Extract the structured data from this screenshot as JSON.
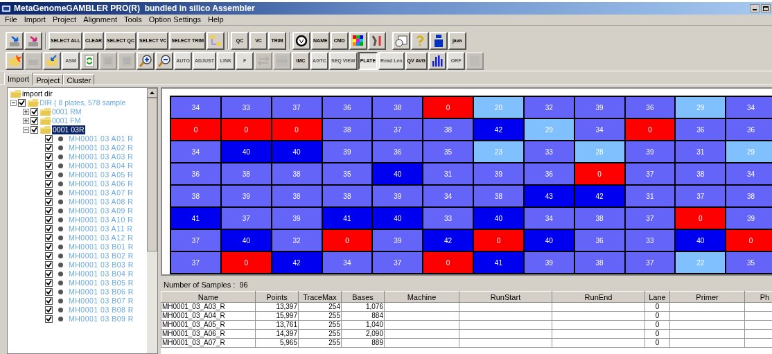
{
  "window": {
    "title": "MetaGenomeGAMBLER PRO(R)  bundled in silico Assembler"
  },
  "menu": [
    "File",
    "Import",
    "Project",
    "Alignment",
    "Tools",
    "Option Settings",
    "Help"
  ],
  "toolbars": [
    [
      {
        "kind": "icon",
        "disabled": false
      },
      {
        "kind": "icon",
        "disabled": false
      },
      {
        "kind": "sep"
      },
      {
        "kind": "text",
        "label": "SELECT ALL",
        "disabled": false
      },
      {
        "kind": "text",
        "label": "CLEAR",
        "disabled": false
      },
      {
        "kind": "text",
        "label": "SELECT QC",
        "disabled": false
      },
      {
        "kind": "text",
        "label": "SELECT VC",
        "disabled": false
      },
      {
        "kind": "text",
        "label": "SELECT TRIM",
        "disabled": false
      },
      {
        "kind": "icon",
        "disabled": false
      },
      {
        "kind": "sep"
      },
      {
        "kind": "text",
        "label": "QC",
        "disabled": false
      },
      {
        "kind": "text",
        "label": "VC",
        "disabled": false
      },
      {
        "kind": "text",
        "label": "TRIM",
        "disabled": false
      },
      {
        "kind": "sep"
      },
      {
        "kind": "icon",
        "disabled": false
      },
      {
        "kind": "text",
        "label": "NAME",
        "disabled": false
      },
      {
        "kind": "text",
        "label": "CMD",
        "disabled": false
      },
      {
        "kind": "icon",
        "disabled": false
      },
      {
        "kind": "icon",
        "disabled": false
      },
      {
        "kind": "sep"
      },
      {
        "kind": "icon",
        "disabled": false
      },
      {
        "kind": "icon",
        "disabled": false
      },
      {
        "kind": "icon",
        "disabled": false
      },
      {
        "kind": "text",
        "label": "java",
        "disabled": false
      }
    ],
    [
      {
        "kind": "icon",
        "disabled": false
      },
      {
        "kind": "icon",
        "disabled": true
      },
      {
        "kind": "icon",
        "disabled": false
      },
      {
        "kind": "text",
        "label": "ASM",
        "disabled": true
      },
      {
        "kind": "icon",
        "disabled": false
      },
      {
        "kind": "icon",
        "disabled": true
      },
      {
        "kind": "icon",
        "disabled": true
      },
      {
        "kind": "icon",
        "disabled": false
      },
      {
        "kind": "icon",
        "disabled": false
      },
      {
        "kind": "text",
        "label": "AUTO",
        "disabled": true
      },
      {
        "kind": "text",
        "label": "ADJUST",
        "disabled": true
      },
      {
        "kind": "text",
        "label": "LINK",
        "disabled": true
      },
      {
        "kind": "text",
        "label": "F",
        "disabled": true
      },
      {
        "kind": "icon",
        "disabled": true
      },
      {
        "kind": "icon",
        "disabled": true
      },
      {
        "kind": "text",
        "label": "IMC",
        "disabled": false
      },
      {
        "kind": "text",
        "label": "AGTC",
        "disabled": true
      },
      {
        "kind": "text",
        "label": "SEQ VIEW",
        "disabled": true
      },
      {
        "kind": "text",
        "label": "PLATE",
        "disabled": false,
        "pressed": true
      },
      {
        "kind": "text",
        "label": "Read Len",
        "disabled": true
      },
      {
        "kind": "text",
        "label": "QV AVG",
        "disabled": false
      },
      {
        "kind": "icon",
        "disabled": false
      },
      {
        "kind": "text",
        "label": "ORF",
        "disabled": true
      },
      {
        "kind": "icon",
        "disabled": true
      }
    ]
  ],
  "tabs": [
    {
      "label": "Import",
      "selected": true
    },
    {
      "label": "Project",
      "selected": false
    },
    {
      "label": "Cluster",
      "selected": false
    }
  ],
  "tree": {
    "label": "import dir",
    "children": [
      {
        "label": "DIR ( 8 plates, 578 sample",
        "checked": true,
        "expanded": true,
        "children": [
          {
            "label": "0001 RM",
            "checked": true,
            "expanded": false,
            "selected": false
          },
          {
            "label": "0001 FM",
            "checked": true,
            "expanded": false,
            "selected": false
          },
          {
            "label": "0001 03R",
            "checked": true,
            "expanded": true,
            "selected": true,
            "children": [
              {
                "label": "MH0001 03 A01 R",
                "checked": true
              },
              {
                "label": "MH0001 03 A02 R",
                "checked": true
              },
              {
                "label": "MH0001 03 A03 R",
                "checked": true
              },
              {
                "label": "MH0001 03 A04 R",
                "checked": true
              },
              {
                "label": "MH0001 03 A05 R",
                "checked": true
              },
              {
                "label": "MH0001 03 A06 R",
                "checked": true
              },
              {
                "label": "MH0001 03 A07 R",
                "checked": true
              },
              {
                "label": "MH0001 03 A08 R",
                "checked": true
              },
              {
                "label": "MH0001 03 A09 R",
                "checked": true
              },
              {
                "label": "MH0001 03 A10 R",
                "checked": true
              },
              {
                "label": "MH0001 03 A11 R",
                "checked": true
              },
              {
                "label": "MH0001 03 A12 R",
                "checked": true
              },
              {
                "label": "MH0001 03 B01 R",
                "checked": true
              },
              {
                "label": "MH0001 03 B02 R",
                "checked": true
              },
              {
                "label": "MH0001 03 B03 R",
                "checked": true
              },
              {
                "label": "MH0001 03 B04 R",
                "checked": true
              },
              {
                "label": "MH0001 03 B05 R",
                "checked": true
              },
              {
                "label": "MH0001 03 B06 R",
                "checked": true
              },
              {
                "label": "MH0001 03 B07 R",
                "checked": true
              },
              {
                "label": "MH0001 03 B08 R",
                "checked": true
              },
              {
                "label": "MH0001 03 B09 R",
                "checked": true
              }
            ]
          }
        ]
      }
    ]
  },
  "plate": [
    {
      "cells": [
        {
          "value": "34",
          "color": "#6464f8"
        },
        {
          "value": "33",
          "color": "#6464f8"
        },
        {
          "value": "37",
          "color": "#6464f8"
        },
        {
          "value": "36",
          "color": "#6464f8"
        },
        {
          "value": "38",
          "color": "#6464f8"
        },
        {
          "value": "0",
          "color": "#ff0000"
        },
        {
          "value": "20",
          "color": "#80c0ff"
        },
        {
          "value": "32",
          "color": "#6464f8"
        },
        {
          "value": "39",
          "color": "#6464f8"
        },
        {
          "value": "36",
          "color": "#6464f8"
        },
        {
          "value": "29",
          "color": "#80c0ff"
        },
        {
          "value": "34",
          "color": "#6464f8"
        }
      ]
    },
    {
      "cells": [
        {
          "value": "0",
          "color": "#ff0000"
        },
        {
          "value": "0",
          "color": "#ff0000"
        },
        {
          "value": "0",
          "color": "#ff0000"
        },
        {
          "value": "38",
          "color": "#6464f8"
        },
        {
          "value": "37",
          "color": "#6464f8"
        },
        {
          "value": "38",
          "color": "#6464f8"
        },
        {
          "value": "42",
          "color": "#0000f0"
        },
        {
          "value": "29",
          "color": "#80c0ff"
        },
        {
          "value": "34",
          "color": "#6464f8"
        },
        {
          "value": "0",
          "color": "#ff0000"
        },
        {
          "value": "36",
          "color": "#6464f8"
        },
        {
          "value": "36",
          "color": "#6464f8"
        }
      ]
    },
    {
      "cells": [
        {
          "value": "34",
          "color": "#6464f8"
        },
        {
          "value": "40",
          "color": "#0000f0"
        },
        {
          "value": "40",
          "color": "#0000f0"
        },
        {
          "value": "39",
          "color": "#6464f8"
        },
        {
          "value": "36",
          "color": "#6464f8"
        },
        {
          "value": "35",
          "color": "#6464f8"
        },
        {
          "value": "23",
          "color": "#80c0ff"
        },
        {
          "value": "33",
          "color": "#6464f8"
        },
        {
          "value": "28",
          "color": "#80c0ff"
        },
        {
          "value": "39",
          "color": "#6464f8"
        },
        {
          "value": "31",
          "color": "#6464f8"
        },
        {
          "value": "29",
          "color": "#80c0ff"
        }
      ]
    },
    {
      "cells": [
        {
          "value": "36",
          "color": "#6464f8"
        },
        {
          "value": "38",
          "color": "#6464f8"
        },
        {
          "value": "38",
          "color": "#6464f8"
        },
        {
          "value": "35",
          "color": "#6464f8"
        },
        {
          "value": "40",
          "color": "#0000f0"
        },
        {
          "value": "31",
          "color": "#6464f8"
        },
        {
          "value": "39",
          "color": "#6464f8"
        },
        {
          "value": "36",
          "color": "#6464f8"
        },
        {
          "value": "0",
          "color": "#ff0000"
        },
        {
          "value": "37",
          "color": "#6464f8"
        },
        {
          "value": "38",
          "color": "#6464f8"
        },
        {
          "value": "34",
          "color": "#6464f8"
        }
      ]
    },
    {
      "cells": [
        {
          "value": "38",
          "color": "#6464f8"
        },
        {
          "value": "39",
          "color": "#6464f8"
        },
        {
          "value": "38",
          "color": "#6464f8"
        },
        {
          "value": "38",
          "color": "#6464f8"
        },
        {
          "value": "39",
          "color": "#6464f8"
        },
        {
          "value": "34",
          "color": "#6464f8"
        },
        {
          "value": "38",
          "color": "#6464f8"
        },
        {
          "value": "43",
          "color": "#0000f0"
        },
        {
          "value": "42",
          "color": "#0000f0"
        },
        {
          "value": "31",
          "color": "#6464f8"
        },
        {
          "value": "37",
          "color": "#6464f8"
        },
        {
          "value": "38",
          "color": "#6464f8"
        }
      ]
    },
    {
      "cells": [
        {
          "value": "41",
          "color": "#0000f0"
        },
        {
          "value": "37",
          "color": "#6464f8"
        },
        {
          "value": "39",
          "color": "#6464f8"
        },
        {
          "value": "41",
          "color": "#0000f0"
        },
        {
          "value": "40",
          "color": "#0000f0"
        },
        {
          "value": "33",
          "color": "#6464f8"
        },
        {
          "value": "40",
          "color": "#0000f0"
        },
        {
          "value": "34",
          "color": "#6464f8"
        },
        {
          "value": "38",
          "color": "#6464f8"
        },
        {
          "value": "37",
          "color": "#6464f8"
        },
        {
          "value": "0",
          "color": "#ff0000"
        },
        {
          "value": "39",
          "color": "#6464f8"
        }
      ]
    },
    {
      "cells": [
        {
          "value": "37",
          "color": "#6464f8"
        },
        {
          "value": "40",
          "color": "#0000f0"
        },
        {
          "value": "32",
          "color": "#6464f8"
        },
        {
          "value": "0",
          "color": "#ff0000"
        },
        {
          "value": "39",
          "color": "#6464f8"
        },
        {
          "value": "42",
          "color": "#0000f0"
        },
        {
          "value": "0",
          "color": "#ff0000"
        },
        {
          "value": "40",
          "color": "#0000f0"
        },
        {
          "value": "36",
          "color": "#6464f8"
        },
        {
          "value": "33",
          "color": "#6464f8"
        },
        {
          "value": "40",
          "color": "#0000f0"
        },
        {
          "value": "0",
          "color": "#ff0000"
        }
      ]
    },
    {
      "cells": [
        {
          "value": "37",
          "color": "#6464f8"
        },
        {
          "value": "0",
          "color": "#ff0000"
        },
        {
          "value": "42",
          "color": "#0000f0"
        },
        {
          "value": "34",
          "color": "#6464f8"
        },
        {
          "value": "37",
          "color": "#6464f8"
        },
        {
          "value": "0",
          "color": "#ff0000"
        },
        {
          "value": "41",
          "color": "#0000f0"
        },
        {
          "value": "39",
          "color": "#6464f8"
        },
        {
          "value": "38",
          "color": "#6464f8"
        },
        {
          "value": "37",
          "color": "#6464f8"
        },
        {
          "value": "22",
          "color": "#80c0ff"
        },
        {
          "value": "35",
          "color": "#6464f8"
        }
      ]
    }
  ],
  "sample_count": {
    "label": "Number of Samples :",
    "value": "96"
  },
  "table": {
    "columns": [
      "Name",
      "Points",
      "TraceMax",
      "Bases",
      "Machine",
      "RunStart",
      "RunEnd",
      "Lane",
      "Primer",
      "Ph"
    ],
    "rows": [
      [
        "MH0001_03_A03_R",
        "13,397",
        "254",
        "1,076",
        "",
        "",
        "",
        "0",
        ""
      ],
      [
        "MH0001_03_A04_R",
        "15,997",
        "255",
        "884",
        "",
        "",
        "",
        "0",
        ""
      ],
      [
        "MH0001_03_A05_R",
        "13,761",
        "255",
        "1,040",
        "",
        "",
        "",
        "0",
        ""
      ],
      [
        "MH0001_03_A06_R",
        "14,397",
        "255",
        "2,090",
        "",
        "",
        "",
        "0",
        ""
      ],
      [
        "MH0001_03_A07_R",
        "5,965",
        "255",
        "889",
        "",
        "",
        "",
        "0",
        ""
      ]
    ]
  }
}
